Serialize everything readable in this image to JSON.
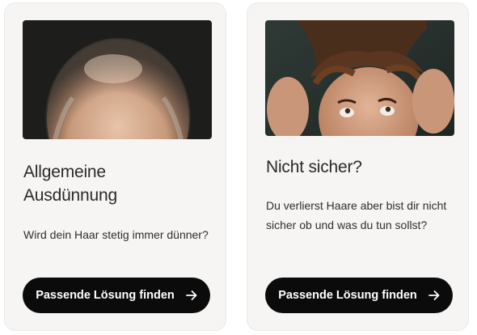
{
  "cards": [
    {
      "image_alt": "Hinterkopf mit schütterem Haar",
      "title_line1": "Allgemeine",
      "title_line2": "Ausdünnung",
      "description": "Wird dein Haar stetig immer dünner?",
      "button_label": "Passende Lösung finden",
      "button_icon": "arrow-right-icon"
    },
    {
      "image_alt": "Mann mit Händen in den Haaren",
      "title_line1": "Nicht sicher?",
      "description_line1": "Du verlierst Haare aber bist dir nicht",
      "description_line2": "sicher ob und was du tun sollst?",
      "button_label": "Passende Lösung finden",
      "button_icon": "arrow-right-icon"
    }
  ],
  "colors": {
    "card_background": "#f6f5f4",
    "button_background": "#0b0b0b",
    "button_text": "#ffffff",
    "text": "#2a2a2a"
  }
}
